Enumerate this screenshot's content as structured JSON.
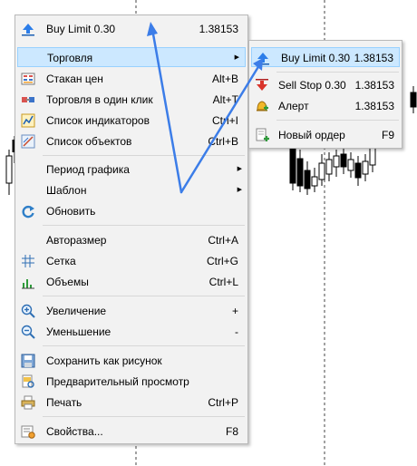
{
  "menu": {
    "items": [
      {
        "label": "Buy Limit 0.30",
        "shortcut": "1.38153",
        "icon": "buy-limit-icon"
      },
      {
        "label": "Торговля",
        "shortcut": "",
        "submenu": true,
        "icon": ""
      },
      {
        "label": "Стакан цен",
        "shortcut": "Alt+B",
        "icon": "depth-of-market-icon"
      },
      {
        "label": "Торговля в один клик",
        "shortcut": "Alt+T",
        "icon": "one-click-trading-icon"
      },
      {
        "label": "Список индикаторов",
        "shortcut": "Ctrl+I",
        "icon": "indicators-list-icon"
      },
      {
        "label": "Список объектов",
        "shortcut": "Ctrl+B",
        "icon": "objects-list-icon"
      },
      {
        "label": "Период графика",
        "shortcut": "",
        "submenu": true,
        "icon": ""
      },
      {
        "label": "Шаблон",
        "shortcut": "",
        "submenu": true,
        "icon": ""
      },
      {
        "label": "Обновить",
        "shortcut": "",
        "icon": "refresh-icon"
      },
      {
        "label": "Авторазмер",
        "shortcut": "Ctrl+A",
        "icon": ""
      },
      {
        "label": "Сетка",
        "shortcut": "Ctrl+G",
        "icon": "grid-icon"
      },
      {
        "label": "Объемы",
        "shortcut": "Ctrl+L",
        "icon": "volumes-icon"
      },
      {
        "label": "Увеличение",
        "shortcut": "+",
        "icon": "zoom-in-icon"
      },
      {
        "label": "Уменьшение",
        "shortcut": "-",
        "icon": "zoom-out-icon"
      },
      {
        "label": "Сохранить как рисунок",
        "shortcut": "",
        "icon": "save-picture-icon"
      },
      {
        "label": "Предварительный просмотр",
        "shortcut": "",
        "icon": "print-preview-icon"
      },
      {
        "label": "Печать",
        "shortcut": "Ctrl+P",
        "icon": "print-icon"
      },
      {
        "label": "Свойства...",
        "shortcut": "F8",
        "icon": "properties-icon"
      }
    ]
  },
  "submenu": {
    "items": [
      {
        "label": "Buy Limit 0.30",
        "value": "1.38153",
        "icon": "buy-limit-icon"
      },
      {
        "label": "Sell Stop 0.30",
        "value": "1.38153",
        "icon": "sell-stop-icon"
      },
      {
        "label": "Алерт",
        "value": "1.38153",
        "icon": "alert-bell-icon"
      },
      {
        "label": "Новый ордер",
        "value": "F9",
        "icon": "new-order-icon"
      }
    ]
  },
  "colors": {
    "highlight": "#cce8ff",
    "highlight_border": "#99d1ff",
    "annotation": "#3c7de8",
    "menu_bg": "#f2f2f2"
  }
}
